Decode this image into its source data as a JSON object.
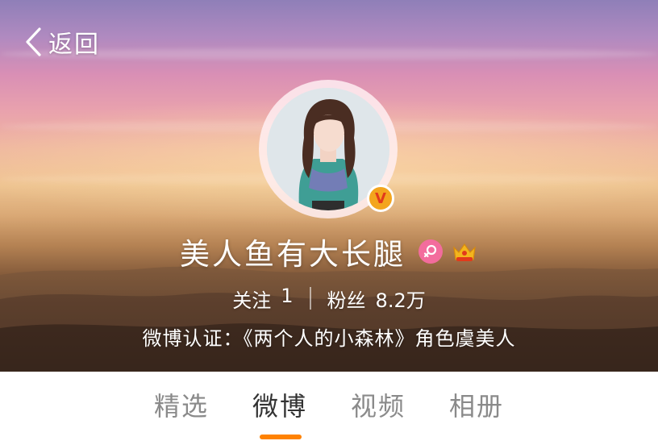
{
  "nav": {
    "back_label": "返回"
  },
  "profile": {
    "name": "美人鱼有大长腿",
    "following_label": "关注",
    "following_count": "1",
    "fans_label": "粉丝",
    "fans_count": "8.2万",
    "verification": "微博认证：《两个人的小森林》角色虞美人",
    "verified_badge": "V",
    "gender_icon": "female-icon",
    "member_icon": "crown-icon"
  },
  "tabs": [
    {
      "label": "精选",
      "active": false
    },
    {
      "label": "微博",
      "active": true
    },
    {
      "label": "视频",
      "active": false
    },
    {
      "label": "相册",
      "active": false
    }
  ],
  "colors": {
    "accent": "#ff8200",
    "tab_inactive": "#8a8a8a",
    "tab_active": "#333333",
    "verified_badge_bg": "#f3a51d",
    "gender_pink": "#f36c9d"
  }
}
